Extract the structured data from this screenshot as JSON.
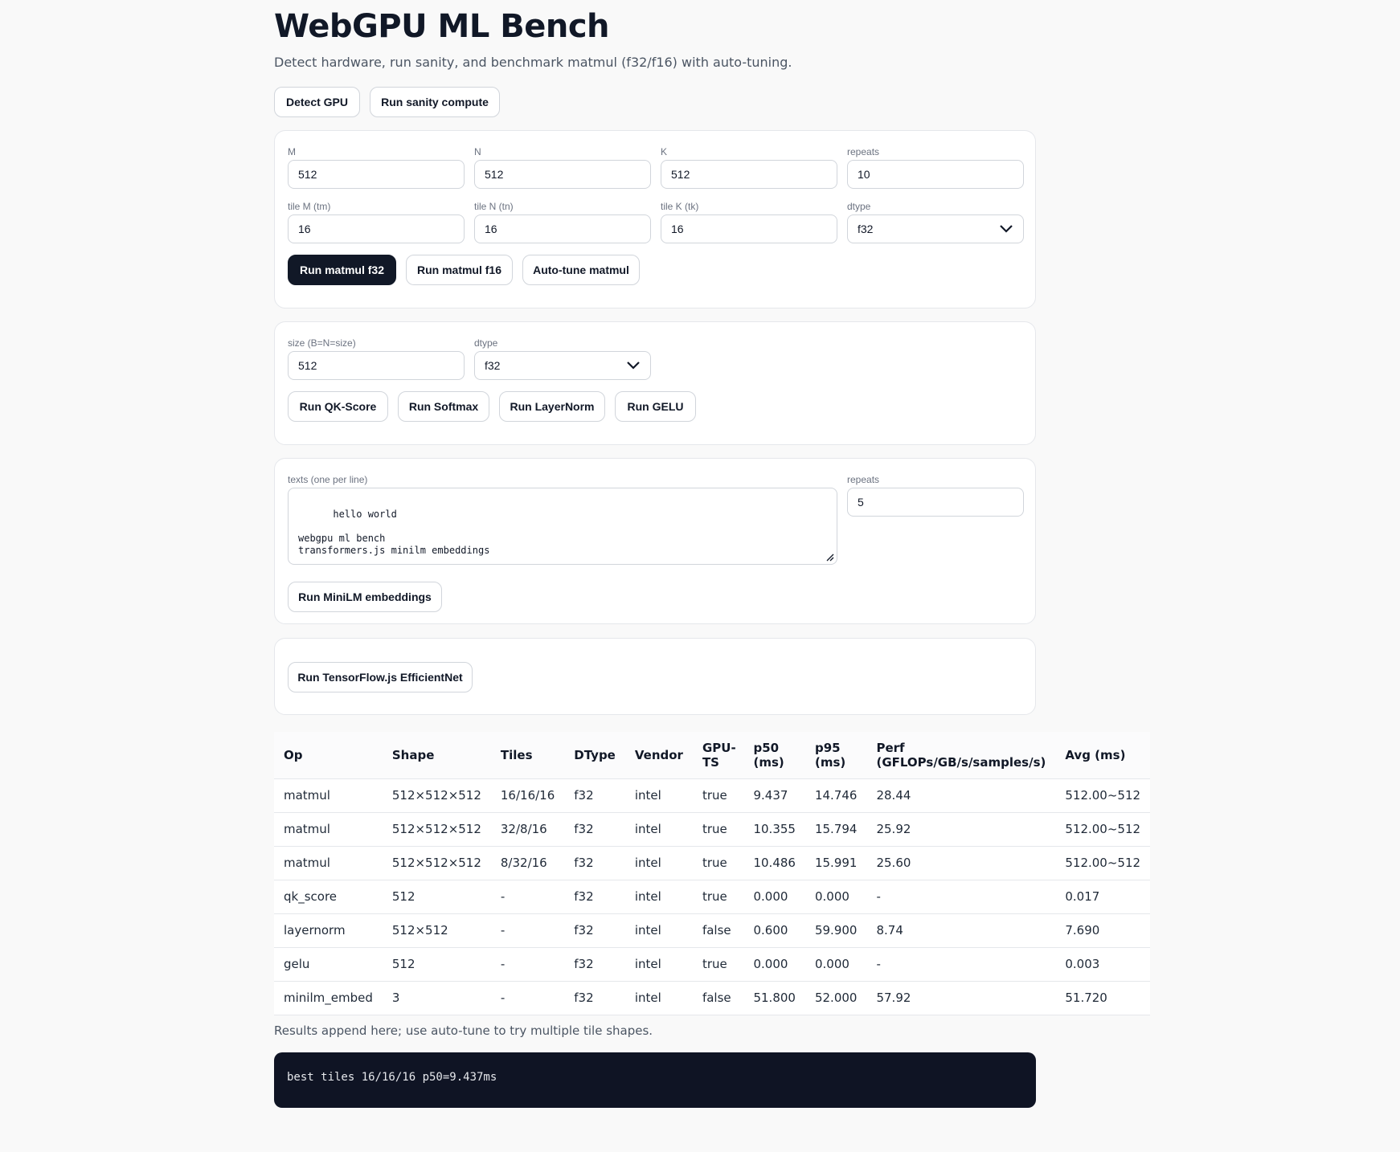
{
  "header": {
    "title": "WebGPU ML Bench",
    "subtitle": "Detect hardware, run sanity, and benchmark matmul (f32/f16) with auto-tuning."
  },
  "toolbar": {
    "detect_gpu": "Detect GPU",
    "run_sanity": "Run sanity compute"
  },
  "matmul": {
    "m_label": "M",
    "m_value": "512",
    "n_label": "N",
    "n_value": "512",
    "k_label": "K",
    "k_value": "512",
    "repeats_label": "repeats",
    "repeats_value": "10",
    "tm_label": "tile M (tm)",
    "tm_value": "16",
    "tn_label": "tile N (tn)",
    "tn_value": "16",
    "tk_label": "tile K (tk)",
    "tk_value": "16",
    "dtype_label": "dtype",
    "dtype_value": "f32",
    "run_f32": "Run matmul f32",
    "run_f16": "Run matmul f16",
    "autotune": "Auto-tune matmul"
  },
  "ops": {
    "size_label": "size (B=N=size)",
    "size_value": "512",
    "dtype_label": "dtype",
    "dtype_value": "f32",
    "run_qk": "Run QK-Score",
    "run_softmax": "Run Softmax",
    "run_layernorm": "Run LayerNorm",
    "run_gelu": "Run GELU"
  },
  "embeddings": {
    "texts_label": "texts (one per line)",
    "texts_value": "hello world\n\nwebgpu ml bench\ntransformers.js minilm embeddings",
    "repeats_label": "repeats",
    "repeats_value": "5",
    "run_minilm": "Run MiniLM embeddings"
  },
  "tfjs": {
    "run_efficientnet": "Run TensorFlow.js EfficientNet"
  },
  "results": {
    "headers": [
      "Op",
      "Shape",
      "Tiles",
      "DType",
      "Vendor",
      "GPU-TS",
      "p50 (ms)",
      "p95 (ms)",
      "Perf (GFLOPs/GB/s/samples/s)",
      "Avg (ms)"
    ],
    "rows": [
      [
        "matmul",
        "512×512×512",
        "16/16/16",
        "f32",
        "intel",
        "true",
        "9.437",
        "14.746",
        "28.44",
        "512.00~512"
      ],
      [
        "matmul",
        "512×512×512",
        "32/8/16",
        "f32",
        "intel",
        "true",
        "10.355",
        "15.794",
        "25.92",
        "512.00~512"
      ],
      [
        "matmul",
        "512×512×512",
        "8/32/16",
        "f32",
        "intel",
        "true",
        "10.486",
        "15.991",
        "25.60",
        "512.00~512"
      ],
      [
        "qk_score",
        "512",
        "-",
        "f32",
        "intel",
        "true",
        "0.000",
        "0.000",
        "-",
        "0.017"
      ],
      [
        "layernorm",
        "512×512",
        "-",
        "f32",
        "intel",
        "false",
        "0.600",
        "59.900",
        "8.74",
        "7.690"
      ],
      [
        "gelu",
        "512",
        "-",
        "f32",
        "intel",
        "true",
        "0.000",
        "0.000",
        "-",
        "0.003"
      ],
      [
        "minilm_embed",
        "3",
        "-",
        "f32",
        "intel",
        "false",
        "51.800",
        "52.000",
        "57.92",
        "51.720"
      ]
    ],
    "note": "Results append here; use auto-tune to try multiple tile shapes."
  },
  "console": {
    "text": "best tiles 16/16/16 p50=9.437ms"
  },
  "colors": {
    "background": "#f9f9f9",
    "primary_button": "#111827",
    "console_bg": "#0f1424"
  },
  "icons": {
    "select_chevron": "chevron-down-icon",
    "textarea_grip": "resize-grip-icon"
  }
}
